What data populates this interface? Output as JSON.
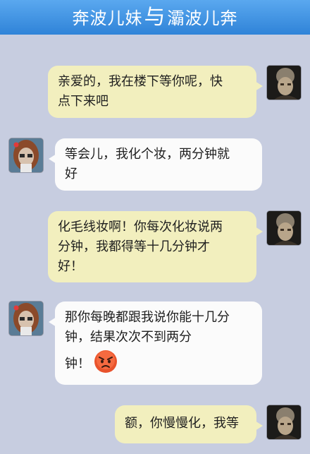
{
  "header": {
    "title_left": "奔波儿妹",
    "title_link": "与",
    "title_right": "灞波儿奔"
  },
  "messages": [
    {
      "side": "right",
      "lines": [
        "亲爱的，我在楼下等你呢，快",
        "点下来吧"
      ]
    },
    {
      "side": "left",
      "lines": [
        "等会儿，我化个妆，两分钟就",
        "好"
      ]
    },
    {
      "side": "right",
      "lines": [
        "化毛线妆啊！你每次化妆说两",
        "分钟，我都得等十几分钟才",
        "好！"
      ]
    },
    {
      "side": "left",
      "lines": [
        "那你每晚都跟我说你能十几分",
        "钟，结果次次不到两分",
        "钟！"
      ],
      "emoji": "angry-face"
    },
    {
      "side": "right",
      "lines": [
        "额，你慢慢化，我等"
      ]
    }
  ],
  "colors": {
    "background": "#c7cde0",
    "header": "#3b8fe0",
    "bubble_right": "#f2efbe",
    "bubble_left": "#fbfbfb"
  }
}
